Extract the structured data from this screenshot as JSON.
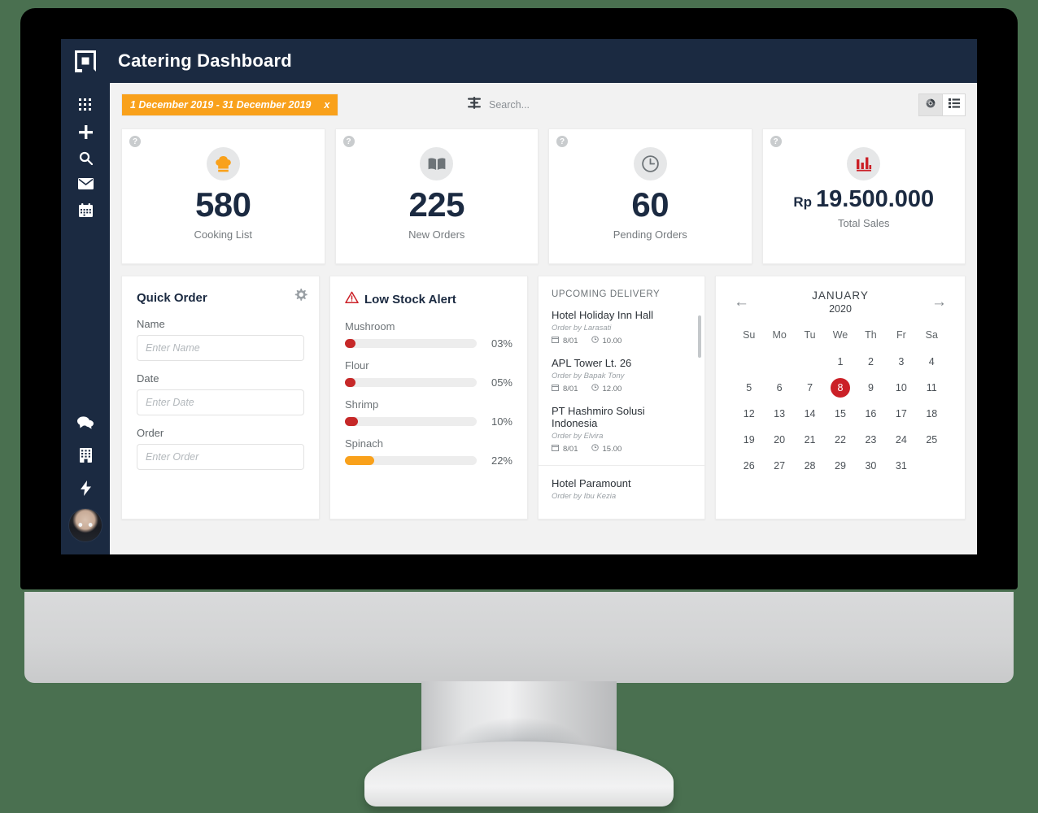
{
  "app": {
    "title": "Catering Dashboard",
    "logo_icon": "square-logo-icon"
  },
  "sidebar": {
    "top_items": [
      {
        "name": "apps-grid-icon",
        "label": "Apps"
      },
      {
        "name": "plus-icon",
        "label": "Add"
      },
      {
        "name": "search-icon",
        "label": "Search"
      },
      {
        "name": "envelope-icon",
        "label": "Messages"
      },
      {
        "name": "calendar-icon",
        "label": "Calendar"
      }
    ],
    "bottom_items": [
      {
        "name": "chat-bubbles-icon",
        "label": "Chat"
      },
      {
        "name": "building-icon",
        "label": "Company"
      },
      {
        "name": "lightning-bolt-icon",
        "label": "Activity"
      }
    ],
    "avatar_label": "User avatar"
  },
  "toolbar": {
    "date_range": "1 December 2019 - 31 December 2019",
    "date_range_close": "x",
    "search_placeholder": "Search...",
    "search_value": "",
    "filter_icon": "filter-sliders-icon",
    "views": [
      {
        "name": "dashboard-view-button",
        "icon": "gauge-icon",
        "active": true
      },
      {
        "name": "list-view-button",
        "icon": "list-icon",
        "active": false
      }
    ]
  },
  "stats": [
    {
      "icon": "chef-hat-icon",
      "value": "580",
      "currency": "",
      "label": "Cooking List",
      "help": "?"
    },
    {
      "icon": "open-book-icon",
      "value": "225",
      "currency": "",
      "label": "New Orders",
      "help": "?"
    },
    {
      "icon": "clock-icon",
      "value": "60",
      "currency": "",
      "label": "Pending Orders",
      "help": "?"
    },
    {
      "icon": "bar-chart-icon",
      "value": "19.500.000",
      "currency": "Rp",
      "label": "Total Sales",
      "help": "?"
    }
  ],
  "quick_order": {
    "title": "Quick Order",
    "gear_icon": "gear-icon",
    "fields": [
      {
        "label": "Name",
        "placeholder": "Enter Name",
        "value": ""
      },
      {
        "label": "Date",
        "placeholder": "Enter Date",
        "value": ""
      },
      {
        "label": "Order",
        "placeholder": "Enter Order",
        "value": ""
      }
    ]
  },
  "low_stock": {
    "title": "Low Stock Alert",
    "warning_icon": "warning-triangle-icon",
    "items": [
      {
        "name": "Mushroom",
        "percent": 3,
        "percent_label": "03%",
        "color": "#c62828"
      },
      {
        "name": "Flour",
        "percent": 5,
        "percent_label": "05%",
        "color": "#c62828"
      },
      {
        "name": "Shrimp",
        "percent": 10,
        "percent_label": "10%",
        "color": "#c62828"
      },
      {
        "name": "Spinach",
        "percent": 22,
        "percent_label": "22%",
        "color": "#f9a11b"
      }
    ]
  },
  "delivery": {
    "title": "UPCOMING DELIVERY",
    "items": [
      {
        "name": "Hotel Holiday Inn Hall",
        "order_by": "Order by Larasati",
        "date": "8/01",
        "time": "10.00"
      },
      {
        "name": "APL Tower Lt. 26",
        "order_by": "Order by Bapak Tony",
        "date": "8/01",
        "time": "12.00"
      },
      {
        "name": "PT Hashmiro Solusi Indonesia",
        "order_by": "Order by Elvira",
        "date": "8/01",
        "time": "15.00"
      },
      {
        "name": "Hotel Paramount",
        "order_by": "Order by Ibu Kezia",
        "date": "",
        "time": ""
      }
    ]
  },
  "calendar": {
    "prev_icon": "arrow-left-icon",
    "next_icon": "arrow-right-icon",
    "month": "JANUARY",
    "year": "2020",
    "dow": [
      "Su",
      "Mo",
      "Tu",
      "We",
      "Th",
      "Fr",
      "Sa"
    ],
    "lead_blanks": 3,
    "days": [
      1,
      2,
      3,
      4,
      5,
      6,
      7,
      8,
      9,
      10,
      11,
      12,
      13,
      14,
      15,
      16,
      17,
      18,
      19,
      20,
      21,
      22,
      23,
      24,
      25,
      26,
      27,
      28,
      29,
      30,
      31
    ],
    "today": 8,
    "today_color": "#cb2027"
  },
  "colors": {
    "brand_dark": "#1b2a41",
    "accent_orange": "#f9a11b",
    "alert_red": "#c62828",
    "page_bg": "#f2f2f2",
    "desktop_bg": "#4a7050"
  }
}
